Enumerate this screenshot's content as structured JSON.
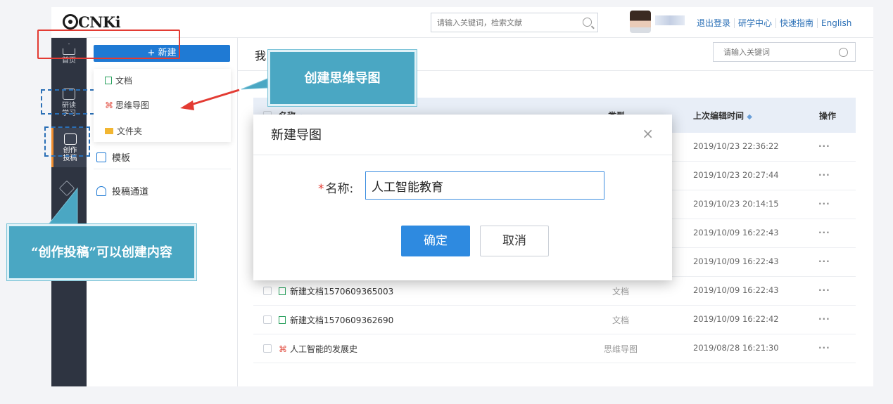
{
  "header": {
    "logo_text": "CNKi",
    "search_placeholder": "请输入关键词，检索文献",
    "links": [
      "退出登录",
      "研学中心",
      "快速指南",
      "English"
    ]
  },
  "leftnav": {
    "items": [
      {
        "label": "首页"
      },
      {
        "label": "研读学习"
      },
      {
        "label": "创作投稿"
      }
    ]
  },
  "create_panel": {
    "new_button": "+ 新建",
    "menu": [
      "文档",
      "思维导图",
      "文件夹"
    ],
    "items": [
      "模板",
      "投稿通道"
    ]
  },
  "main": {
    "title": "我",
    "search_placeholder": "请输入关键词",
    "columns": {
      "name": "名称",
      "type": "类型",
      "time": "上次编辑时间",
      "action": "操作"
    },
    "rows": [
      {
        "name": "",
        "type": "",
        "time": "2019/10/23 22:36:22",
        "op": "···"
      },
      {
        "name": "",
        "type": "",
        "time": "2019/10/23 20:27:44",
        "op": "···"
      },
      {
        "name": "",
        "type": "",
        "time": "2019/10/23 20:14:15",
        "op": "···"
      },
      {
        "name": "",
        "type": "",
        "time": "2019/10/09 16:22:43",
        "op": "···"
      },
      {
        "name": "",
        "type": "",
        "time": "2019/10/09 16:22:43",
        "op": "···"
      },
      {
        "name": "新建文档1570609365003",
        "type": "文档",
        "time": "2019/10/09 16:22:43",
        "op": "···"
      },
      {
        "name": "新建文档1570609362690",
        "type": "文档",
        "time": "2019/10/09 16:22:42",
        "op": "···"
      },
      {
        "name": "人工智能的发展史",
        "type": "思维导图",
        "time": "2019/08/28 16:21:30",
        "op": "···"
      }
    ]
  },
  "dialog": {
    "title": "新建导图",
    "label": "名称:",
    "required_mark": "*",
    "input_value": "人工智能教育",
    "ok": "确定",
    "cancel": "取消",
    "close": "×"
  },
  "callouts": {
    "mindmap": "创建思维导图",
    "nav": "“创作投稿”可以创建内容"
  },
  "colors": {
    "accent": "#1f7ad4",
    "callout": "#4aa7c3",
    "highlight_red": "#e33b33",
    "dashed_blue": "#2a6fb6"
  }
}
